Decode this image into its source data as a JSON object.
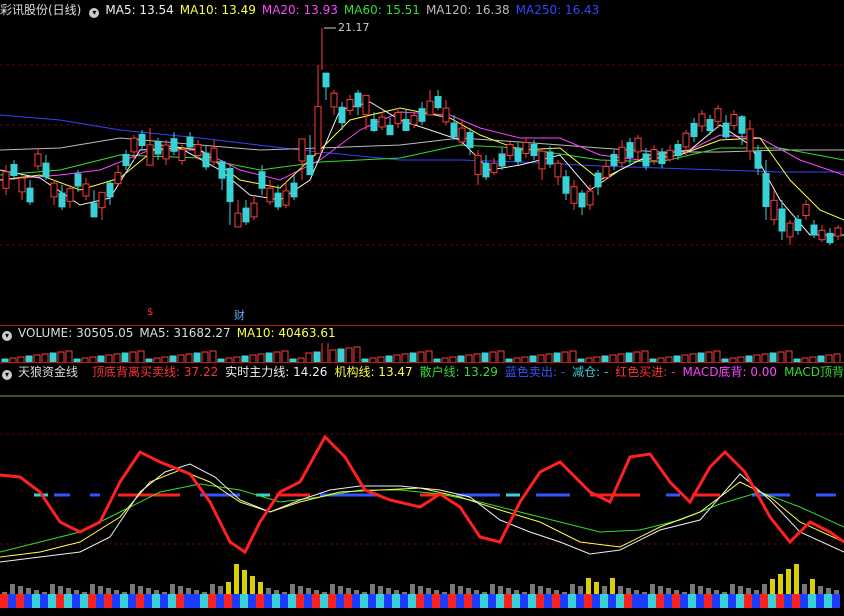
{
  "header": {
    "title": "彩讯股份(日线)",
    "ma_items": [
      {
        "label": "MA5: 13.54",
        "color": "#f0f0f0"
      },
      {
        "label": "MA10: 13.49",
        "color": "#ffff44"
      },
      {
        "label": "MA20: 13.93",
        "color": "#ff44ff"
      },
      {
        "label": "MA60: 15.51",
        "color": "#33dd33"
      },
      {
        "label": "MA120: 16.38",
        "color": "#bbbbbb"
      },
      {
        "label": "MA250: 16.43",
        "color": "#3344ff"
      }
    ]
  },
  "price_panel": {
    "high_marker": "21.17",
    "event_marks": [
      {
        "text": "$",
        "color": "#ff3333"
      },
      {
        "text": "财",
        "color": "#66aaff"
      }
    ]
  },
  "volume_panel": {
    "items": [
      {
        "label": "VOLUME: 30505.05",
        "color": "#dddddd"
      },
      {
        "label": "MA5: 31682.27",
        "color": "#dddddd"
      },
      {
        "label": "MA10: 40463.61",
        "color": "#ffff44"
      }
    ]
  },
  "indicator_panel": {
    "title": "天狼资金线",
    "items": [
      {
        "label": "顶底背离买卖线: 37.22",
        "color": "#ff3333"
      },
      {
        "label": "实时主力线: 14.26",
        "color": "#f0f0f0"
      },
      {
        "label": "机构线: 13.47",
        "color": "#ffff44"
      },
      {
        "label": "散户线: 13.29",
        "color": "#33dd33"
      },
      {
        "label": "蓝色卖出: -",
        "color": "#3355ff"
      },
      {
        "label": "减仓: -",
        "color": "#39d0d6"
      },
      {
        "label": "红色买进: -",
        "color": "#ff3333"
      },
      {
        "label": "MACD底背: 0.00",
        "color": "#ff44ff"
      },
      {
        "label": "MACD顶背:",
        "color": "#33dd33"
      }
    ]
  },
  "colors": {
    "up": "#ff3a3a",
    "down": "#39d0d6",
    "grid": "#6a0000",
    "separator": "#b02020"
  }
}
